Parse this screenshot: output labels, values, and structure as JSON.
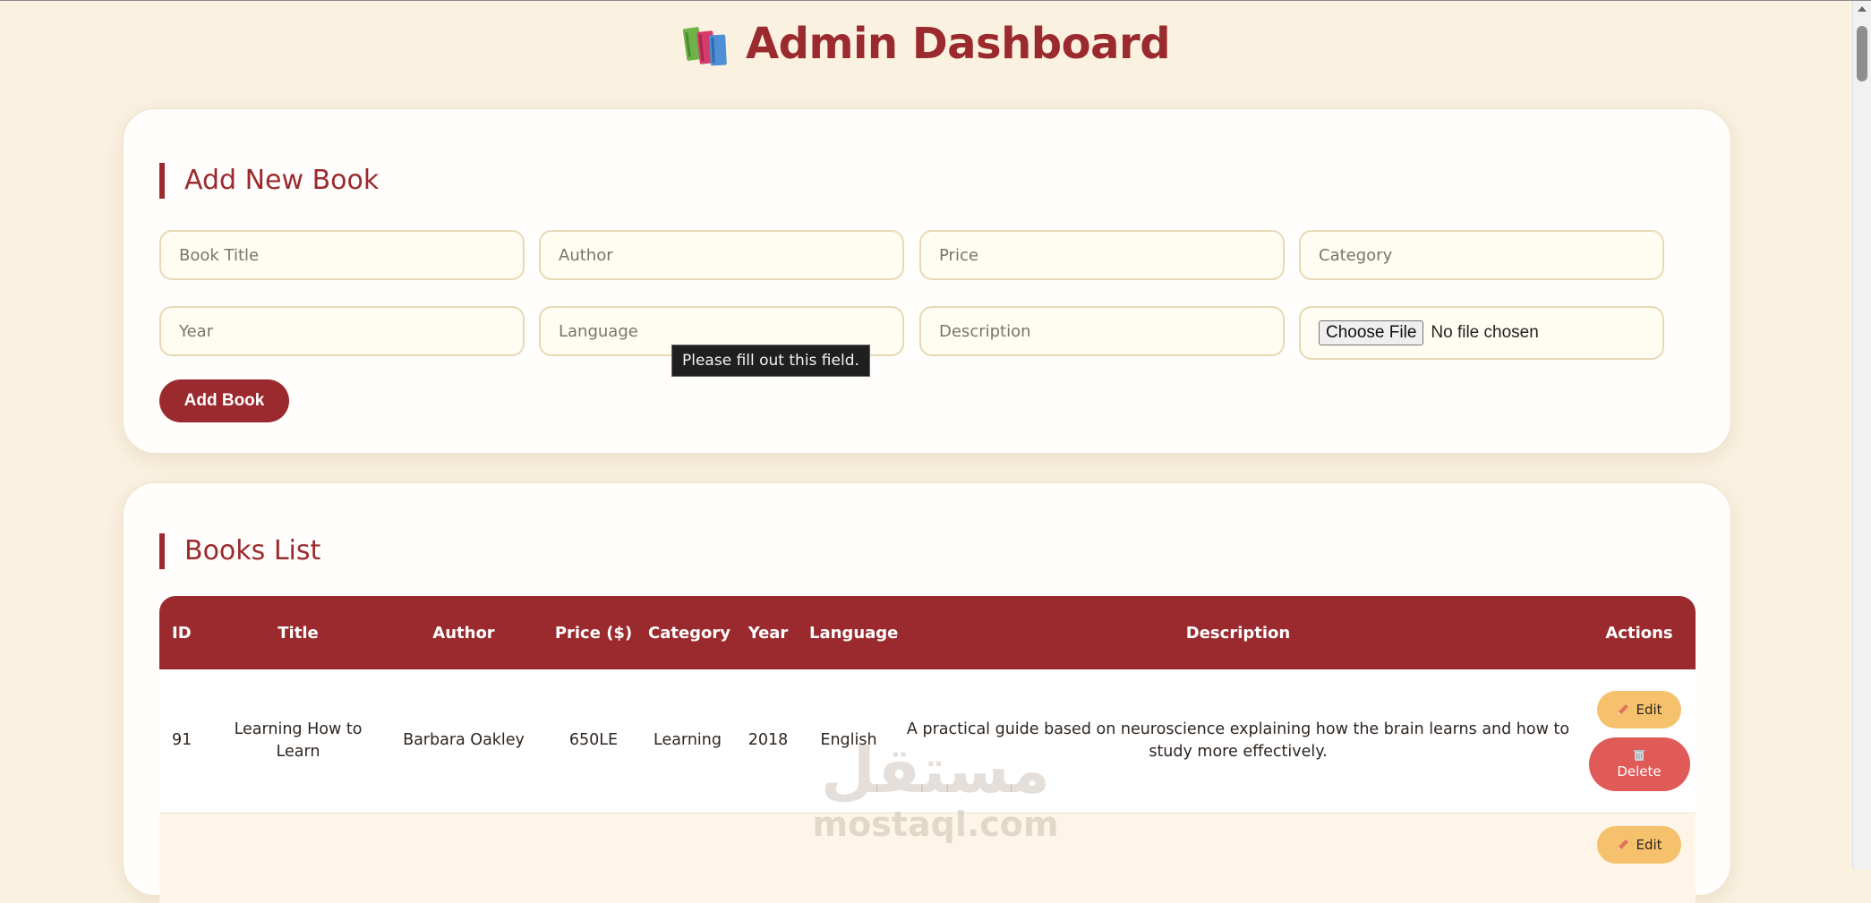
{
  "header": {
    "title": "Admin Dashboard",
    "icon": "books-icon"
  },
  "form": {
    "heading": "Add New Book",
    "fields": {
      "title": "Book Title",
      "author": "Author",
      "price": "Price",
      "category": "Category",
      "year": "Year",
      "language": "Language",
      "description": "Description"
    },
    "file": {
      "button": "Choose File",
      "status": "No file chosen"
    },
    "submit": "Add Book",
    "tooltip": "Please fill out this field."
  },
  "list": {
    "heading": "Books List",
    "columns": [
      "ID",
      "Title",
      "Author",
      "Price ($)",
      "Category",
      "Year",
      "Language",
      "Description",
      "Actions"
    ],
    "rows": [
      {
        "id": "91",
        "title": "Learning How to Learn",
        "author": "Barbara Oakley",
        "price": "650LE",
        "category": "Learning",
        "year": "2018",
        "language": "English",
        "description": "A practical guide based on neuroscience explaining how the brain learns and how to study more effectively."
      }
    ],
    "actions": {
      "edit": "Edit",
      "delete": "Delete"
    }
  },
  "watermark": {
    "arabic": "مستقل",
    "latin": "mostaql.com"
  },
  "colors": {
    "background": "#faf1e1",
    "accent": "#9b2a2e",
    "edit": "#f5c16c",
    "delete": "#e05a57"
  }
}
